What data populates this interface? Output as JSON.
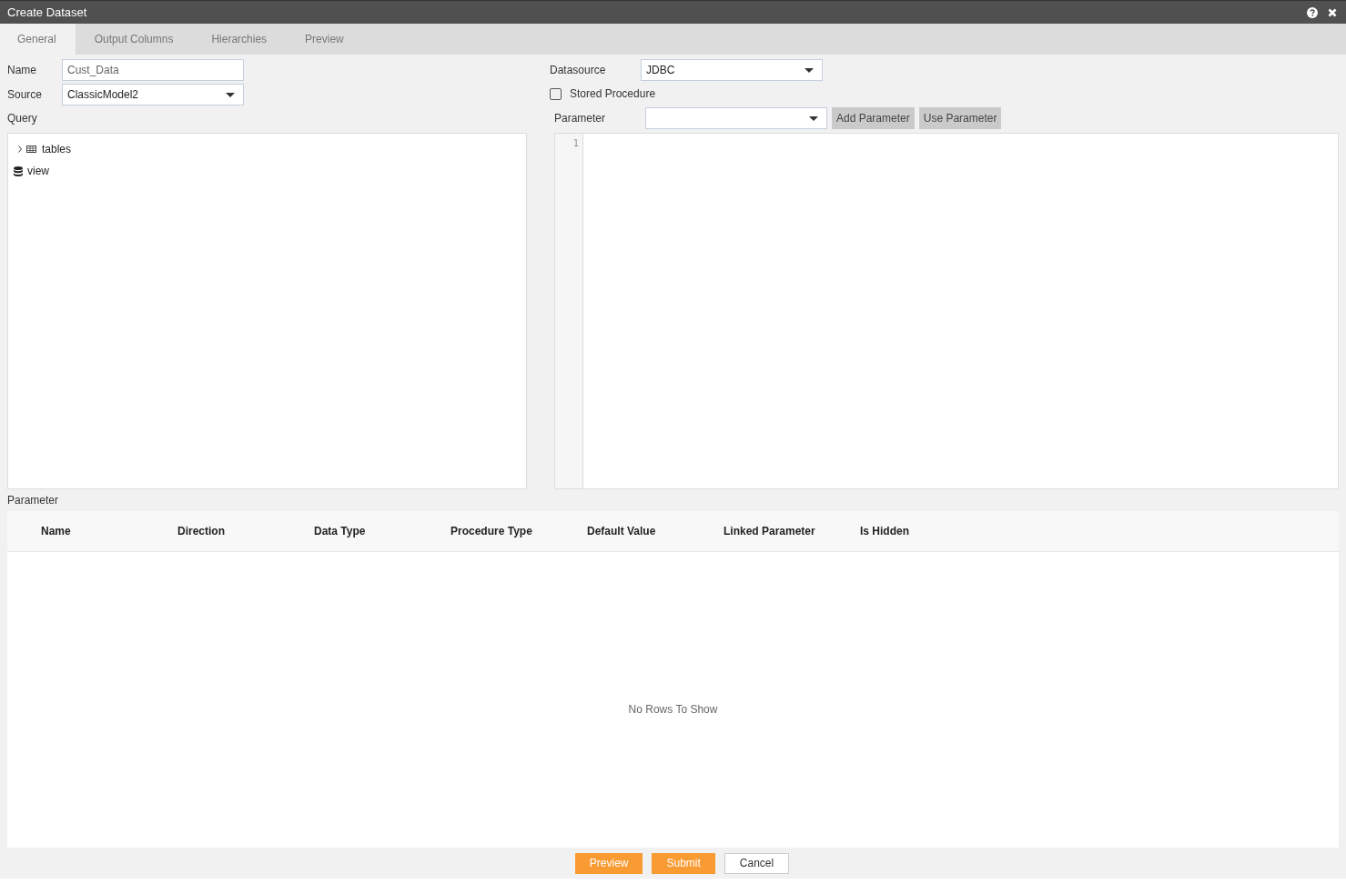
{
  "window": {
    "title": "Create Dataset"
  },
  "tabs": [
    {
      "label": "General",
      "selected": true
    },
    {
      "label": "Output Columns",
      "selected": false
    },
    {
      "label": "Hierarchies",
      "selected": false
    },
    {
      "label": "Preview",
      "selected": false
    }
  ],
  "name_field": {
    "label": "Name",
    "value": "Cust_Data"
  },
  "source_field": {
    "label": "Source",
    "value": "ClassicModel2"
  },
  "query": {
    "label": "Query",
    "tree": [
      {
        "label": "tables",
        "kind": "table",
        "expanded": false
      },
      {
        "label": "view",
        "kind": "view"
      }
    ]
  },
  "datasource_field": {
    "label": "Datasource",
    "value": "JDBC"
  },
  "stored_procedure": {
    "label": "Stored Procedure",
    "checked": false
  },
  "parameter_field": {
    "label": "Parameter",
    "buttons": [
      "Add Parameter",
      "Use Parameter"
    ]
  },
  "editor": {
    "line_numbers": [
      "1"
    ]
  },
  "parameter_table": {
    "title": "Parameter",
    "columns": [
      "Name",
      "Direction",
      "Data Type",
      "Procedure Type",
      "Default Value",
      "Linked Parameter",
      "Is Hidden"
    ],
    "empty_text": "No Rows To Show"
  },
  "buttons": [
    {
      "label": "Preview",
      "kind": "primary"
    },
    {
      "label": "Submit",
      "kind": "primary"
    },
    {
      "label": "Cancel",
      "kind": "secondary"
    }
  ]
}
